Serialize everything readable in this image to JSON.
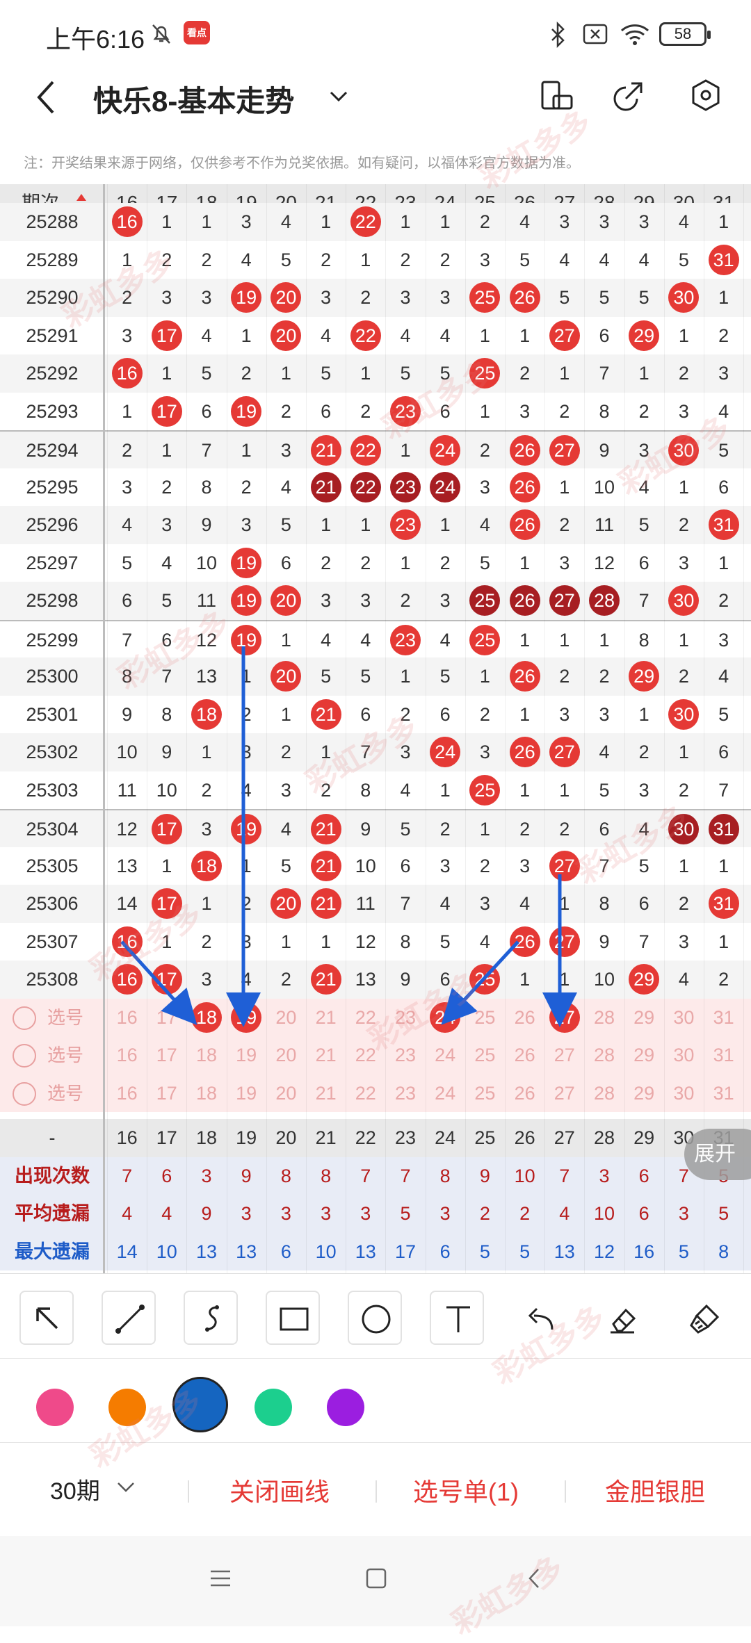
{
  "status_bar": {
    "time": "上午6:16",
    "app_badge": "看点",
    "battery": "58"
  },
  "header": {
    "title": "快乐8-基本走势"
  },
  "notice": "注：开奖结果来源于网络，仅供参考不作为兑奖依据。如有疑问，以福体彩官方数据为准。",
  "table": {
    "issue_header": "期次",
    "columns": [
      "16",
      "17",
      "18",
      "19",
      "20",
      "21",
      "22",
      "23",
      "24",
      "25",
      "26",
      "27",
      "28",
      "29",
      "30",
      "31"
    ],
    "rows": [
      {
        "issue": "25288",
        "cells": [
          "16",
          "1",
          "1",
          "3",
          "4",
          "1",
          "22",
          "1",
          "1",
          "2",
          "4",
          "3",
          "3",
          "3",
          "4",
          "1"
        ],
        "hits": [
          0,
          6
        ]
      },
      {
        "issue": "25289",
        "cells": [
          "1",
          "2",
          "2",
          "4",
          "5",
          "2",
          "1",
          "2",
          "2",
          "3",
          "5",
          "4",
          "4",
          "4",
          "5",
          "31"
        ],
        "hits": [
          15
        ]
      },
      {
        "issue": "25290",
        "cells": [
          "2",
          "3",
          "3",
          "19",
          "20",
          "3",
          "2",
          "3",
          "3",
          "25",
          "26",
          "5",
          "5",
          "5",
          "30",
          "1"
        ],
        "hits": [
          3,
          4,
          9,
          10,
          14
        ]
      },
      {
        "issue": "25291",
        "cells": [
          "3",
          "17",
          "4",
          "1",
          "20",
          "4",
          "22",
          "4",
          "4",
          "1",
          "1",
          "27",
          "6",
          "29",
          "1",
          "2"
        ],
        "hits": [
          1,
          4,
          6,
          11,
          13
        ]
      },
      {
        "issue": "25292",
        "cells": [
          "16",
          "1",
          "5",
          "2",
          "1",
          "5",
          "1",
          "5",
          "5",
          "25",
          "2",
          "1",
          "7",
          "1",
          "2",
          "3"
        ],
        "hits": [
          0,
          9
        ]
      },
      {
        "issue": "25293",
        "cells": [
          "1",
          "17",
          "6",
          "19",
          "2",
          "6",
          "2",
          "23",
          "6",
          "1",
          "3",
          "2",
          "8",
          "2",
          "3",
          "4"
        ],
        "hits": [
          1,
          3,
          7
        ]
      },
      {
        "issue": "25294",
        "cells": [
          "2",
          "1",
          "7",
          "1",
          "3",
          "21",
          "22",
          "1",
          "24",
          "2",
          "26",
          "27",
          "9",
          "3",
          "30",
          "5"
        ],
        "hits": [
          5,
          6,
          8,
          10,
          11,
          14
        ]
      },
      {
        "issue": "25295",
        "cells": [
          "3",
          "2",
          "8",
          "2",
          "4",
          "21",
          "22",
          "23",
          "24",
          "3",
          "26",
          "1",
          "10",
          "4",
          "1",
          "6"
        ],
        "hits": [
          5,
          6,
          7,
          8,
          10
        ],
        "dark": [
          5,
          6,
          7,
          8
        ]
      },
      {
        "issue": "25296",
        "cells": [
          "4",
          "3",
          "9",
          "3",
          "5",
          "1",
          "1",
          "23",
          "1",
          "4",
          "26",
          "2",
          "11",
          "5",
          "2",
          "31"
        ],
        "hits": [
          7,
          10,
          15
        ]
      },
      {
        "issue": "25297",
        "cells": [
          "5",
          "4",
          "10",
          "19",
          "6",
          "2",
          "2",
          "1",
          "2",
          "5",
          "1",
          "3",
          "12",
          "6",
          "3",
          "1"
        ],
        "hits": [
          3
        ]
      },
      {
        "issue": "25298",
        "cells": [
          "6",
          "5",
          "11",
          "19",
          "20",
          "3",
          "3",
          "2",
          "3",
          "25",
          "26",
          "27",
          "28",
          "7",
          "30",
          "2"
        ],
        "hits": [
          3,
          4,
          9,
          10,
          11,
          12,
          14
        ],
        "dark": [
          9,
          10,
          11,
          12
        ]
      },
      {
        "issue": "25299",
        "cells": [
          "7",
          "6",
          "12",
          "19",
          "1",
          "4",
          "4",
          "23",
          "4",
          "25",
          "1",
          "1",
          "1",
          "8",
          "1",
          "3"
        ],
        "hits": [
          3,
          7,
          9
        ]
      },
      {
        "issue": "25300",
        "cells": [
          "8",
          "7",
          "13",
          "1",
          "20",
          "5",
          "5",
          "1",
          "5",
          "1",
          "26",
          "2",
          "2",
          "29",
          "2",
          "4"
        ],
        "hits": [
          4,
          10,
          13
        ]
      },
      {
        "issue": "25301",
        "cells": [
          "9",
          "8",
          "18",
          "2",
          "1",
          "21",
          "6",
          "2",
          "6",
          "2",
          "1",
          "3",
          "3",
          "1",
          "30",
          "5"
        ],
        "hits": [
          2,
          5,
          14
        ]
      },
      {
        "issue": "25302",
        "cells": [
          "10",
          "9",
          "1",
          "3",
          "2",
          "1",
          "7",
          "3",
          "24",
          "3",
          "26",
          "27",
          "4",
          "2",
          "1",
          "6"
        ],
        "hits": [
          8,
          10,
          11
        ]
      },
      {
        "issue": "25303",
        "cells": [
          "11",
          "10",
          "2",
          "4",
          "3",
          "2",
          "8",
          "4",
          "1",
          "25",
          "1",
          "1",
          "5",
          "3",
          "2",
          "7"
        ],
        "hits": [
          9
        ]
      },
      {
        "issue": "25304",
        "cells": [
          "12",
          "17",
          "3",
          "19",
          "4",
          "21",
          "9",
          "5",
          "2",
          "1",
          "2",
          "2",
          "6",
          "4",
          "30",
          "31"
        ],
        "hits": [
          1,
          3,
          5,
          14,
          15
        ],
        "dark": [
          14,
          15
        ]
      },
      {
        "issue": "25305",
        "cells": [
          "13",
          "1",
          "18",
          "1",
          "5",
          "21",
          "10",
          "6",
          "3",
          "2",
          "3",
          "27",
          "7",
          "5",
          "1",
          "1"
        ],
        "hits": [
          2,
          5,
          11
        ]
      },
      {
        "issue": "25306",
        "cells": [
          "14",
          "17",
          "1",
          "2",
          "20",
          "21",
          "11",
          "7",
          "4",
          "3",
          "4",
          "1",
          "8",
          "6",
          "2",
          "31"
        ],
        "hits": [
          1,
          4,
          5,
          15
        ]
      },
      {
        "issue": "25307",
        "cells": [
          "16",
          "1",
          "2",
          "3",
          "1",
          "1",
          "12",
          "8",
          "5",
          "4",
          "26",
          "27",
          "9",
          "7",
          "3",
          "1"
        ],
        "hits": [
          0,
          10,
          11
        ]
      },
      {
        "issue": "25308",
        "cells": [
          "16",
          "17",
          "3",
          "4",
          "2",
          "21",
          "13",
          "9",
          "6",
          "25",
          "1",
          "1",
          "10",
          "29",
          "4",
          "2"
        ],
        "hits": [
          0,
          1,
          5,
          9,
          13
        ]
      }
    ],
    "pick_rows": [
      {
        "label": "选号",
        "hits": [
          2,
          3,
          8,
          11
        ]
      },
      {
        "label": "选号",
        "hits": []
      },
      {
        "label": "选号",
        "hits": []
      }
    ],
    "footer_header": {
      "issue": "-",
      "cells": [
        "16",
        "17",
        "18",
        "19",
        "20",
        "21",
        "22",
        "23",
        "24",
        "25",
        "26",
        "27",
        "28",
        "29",
        "30",
        "31"
      ]
    },
    "stats": [
      {
        "label": "出现次数",
        "values": [
          "7",
          "6",
          "3",
          "9",
          "8",
          "8",
          "7",
          "7",
          "8",
          "9",
          "10",
          "7",
          "3",
          "6",
          "7",
          "5"
        ]
      },
      {
        "label": "平均遗漏",
        "values": [
          "4",
          "4",
          "9",
          "3",
          "3",
          "3",
          "3",
          "5",
          "3",
          "2",
          "2",
          "4",
          "10",
          "6",
          "3",
          "5"
        ]
      },
      {
        "label": "最大遗漏",
        "values": [
          "14",
          "10",
          "13",
          "13",
          "6",
          "10",
          "13",
          "17",
          "6",
          "5",
          "5",
          "13",
          "12",
          "16",
          "5",
          "8"
        ]
      }
    ]
  },
  "expand_button": "展开",
  "tools": [
    "select-arrow-icon",
    "line-icon",
    "freehand-icon",
    "rectangle-icon",
    "circle-icon",
    "text-icon",
    "undo-icon",
    "eraser-icon",
    "clear-icon"
  ],
  "colors": {
    "pink": "#ef4a8a",
    "orange": "#f57c00",
    "blue": "#1565c0",
    "green": "#1ccf8e",
    "purple": "#9b1ee0",
    "ball_red": "#e53935",
    "ball_dark": "#a71e22",
    "arrow": "#1f5fd6"
  },
  "bottom_bar": {
    "period": "30期",
    "close_lines": "关闭画线",
    "pick_list": "选号单(1)",
    "gold_silver": "金胆银胆"
  },
  "watermark": "彩虹多多"
}
